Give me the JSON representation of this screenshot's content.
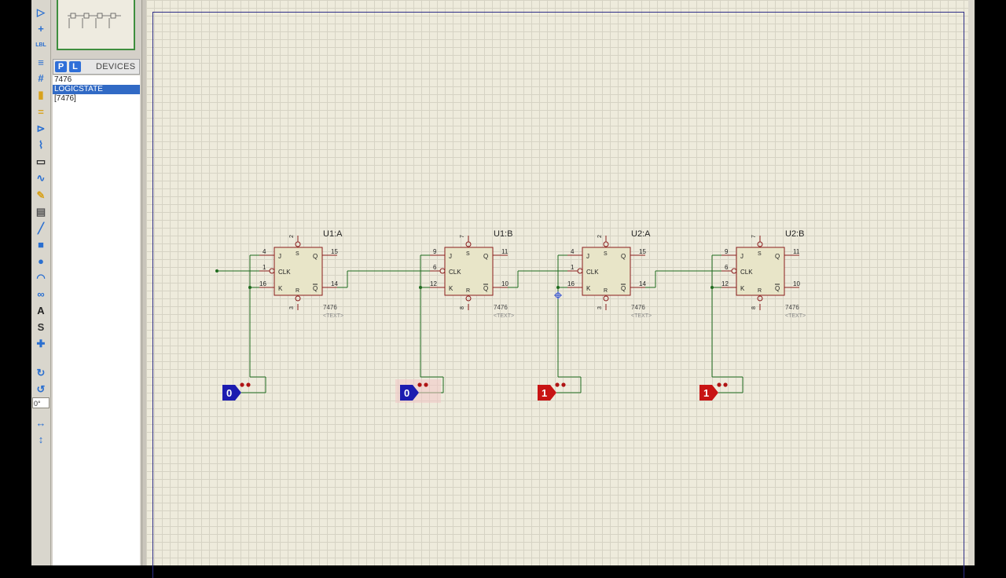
{
  "toolbar": {
    "tools": [
      {
        "name": "selection-mode-icon",
        "glyph": "▷"
      },
      {
        "name": "junction-dot-icon",
        "glyph": "+"
      },
      {
        "name": "wire-label-icon",
        "glyph": "LBL"
      },
      {
        "name": "text-script-icon",
        "glyph": "≡"
      },
      {
        "name": "bus-icon",
        "glyph": "#"
      },
      {
        "name": "subcircuit-icon",
        "glyph": "▮"
      },
      {
        "name": "terminals-icon",
        "glyph": "="
      },
      {
        "name": "device-pins-icon",
        "glyph": "⊳"
      },
      {
        "name": "graph-icon",
        "glyph": "⌇"
      },
      {
        "name": "tape-recorder-icon",
        "glyph": "▭"
      },
      {
        "name": "generator-icon",
        "glyph": "∿"
      },
      {
        "name": "voltage-probe-icon",
        "glyph": "✎"
      },
      {
        "name": "virtual-instrument-icon",
        "glyph": "▤"
      },
      {
        "name": "line-icon",
        "glyph": "╱"
      },
      {
        "name": "box-icon",
        "glyph": "■"
      },
      {
        "name": "circle-icon",
        "glyph": "●"
      },
      {
        "name": "arc-icon",
        "glyph": "◠"
      },
      {
        "name": "path-icon",
        "glyph": "∞"
      },
      {
        "name": "text-icon",
        "glyph": "A"
      },
      {
        "name": "symbol-icon",
        "glyph": "S"
      },
      {
        "name": "marker-icon",
        "glyph": "✚"
      },
      {
        "name": "rotate-clockwise-icon",
        "glyph": "↻"
      },
      {
        "name": "rotate-anticlockwise-icon",
        "glyph": "↺"
      },
      {
        "name": "mirror-x-icon",
        "glyph": "↔"
      },
      {
        "name": "mirror-y-icon",
        "glyph": "↕"
      }
    ],
    "rotation_value": "0°"
  },
  "devices": {
    "p_button": "P",
    "l_button": "L",
    "title": "DEVICES",
    "items": [
      "7476",
      "LOGICSTATE",
      "[7476]"
    ],
    "selected_index": 1
  },
  "schematic": {
    "flip_flops": [
      {
        "ref": "U1:A",
        "part": "7476",
        "text": "<TEXT>",
        "pins": {
          "set": "2",
          "j": "4",
          "clk": "1",
          "k": "16",
          "reset": "3",
          "q": "15",
          "qbar": "14"
        }
      },
      {
        "ref": "U1:B",
        "part": "7476",
        "text": "<TEXT>",
        "pins": {
          "set": "7",
          "j": "9",
          "clk": "6",
          "k": "12",
          "reset": "8",
          "q": "11",
          "qbar": "10"
        }
      },
      {
        "ref": "U2:A",
        "part": "7476",
        "text": "<TEXT>",
        "pins": {
          "set": "2",
          "j": "4",
          "clk": "1",
          "k": "16",
          "reset": "3",
          "q": "15",
          "qbar": "14"
        }
      },
      {
        "ref": "U2:B",
        "part": "7476",
        "text": "<TEXT>",
        "pins": {
          "set": "7",
          "j": "9",
          "clk": "6",
          "k": "12",
          "reset": "8",
          "q": "11",
          "qbar": "10"
        }
      }
    ],
    "pin_labels": {
      "j": "J",
      "k": "K",
      "clk": "CLK",
      "q": "Q",
      "qbar": "Q",
      "set": "S",
      "reset": "R"
    },
    "logic_states": [
      {
        "value": "0",
        "color": "#1c1cb0"
      },
      {
        "value": "0",
        "color": "#1c1cb0"
      },
      {
        "value": "1",
        "color": "#c81414"
      },
      {
        "value": "1",
        "color": "#c81414"
      }
    ]
  },
  "colors": {
    "wire": "#1e6b1e",
    "component_border": "#8a1c1c",
    "component_fill": "#e8e5c8",
    "sheet_border": "#2e2e86"
  }
}
